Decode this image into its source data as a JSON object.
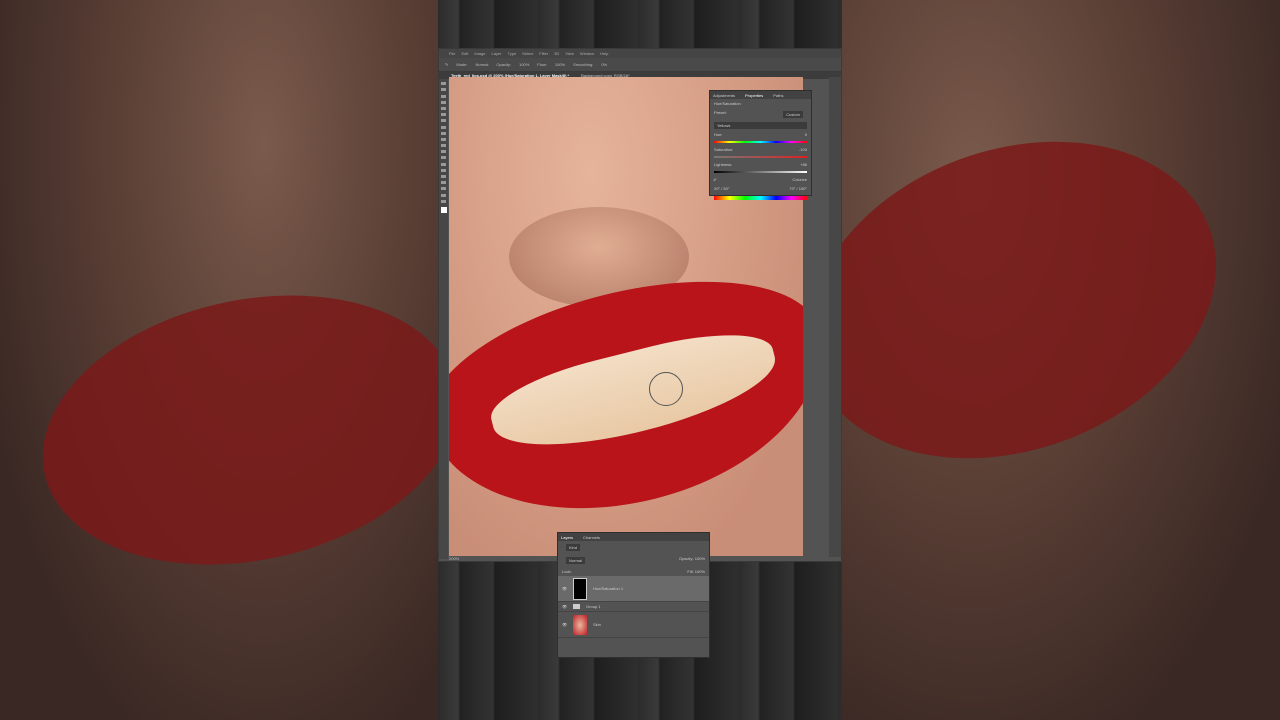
{
  "menu": [
    "File",
    "Edit",
    "Image",
    "Layer",
    "Type",
    "Select",
    "Filter",
    "3D",
    "View",
    "Window",
    "Help"
  ],
  "options": {
    "mode_label": "Mode:",
    "mode": "Normal",
    "opacity_label": "Opacity:",
    "opacity": "100%",
    "flow_label": "Flow:",
    "flow": "100%",
    "smoothing_label": "Smoothing:",
    "smoothing": "0%"
  },
  "doc_tabs": [
    "Teeth_red_lips.psd @ 200% (Hue/Saturation 1, Layer Mask/8) *",
    "Background copy, RGB/16*"
  ],
  "status": "200%",
  "properties": {
    "tabs": [
      "Adjustments",
      "Properties",
      "Paths"
    ],
    "title": "Hue/Saturation",
    "preset_label": "Preset:",
    "preset": "Custom",
    "channel": "Yellows",
    "hue_label": "Hue:",
    "hue": "0",
    "sat_label": "Saturation:",
    "sat": "-100",
    "light_label": "Lightness:",
    "light": "+86",
    "colorize": "Colorize",
    "range_left": "20° / 50°",
    "range_right": "70° / 100°"
  },
  "layers": {
    "tabs": [
      "Layers",
      "Channels"
    ],
    "kind": "Kind",
    "blend": "Normal",
    "opacity_label": "Opacity:",
    "opacity": "100%",
    "lock_label": "Lock:",
    "fill_label": "Fill:",
    "fill": "100%",
    "items": [
      {
        "name": "Hue/Saturation 1"
      },
      {
        "name": "Group 1"
      },
      {
        "name": "Skin"
      }
    ]
  }
}
